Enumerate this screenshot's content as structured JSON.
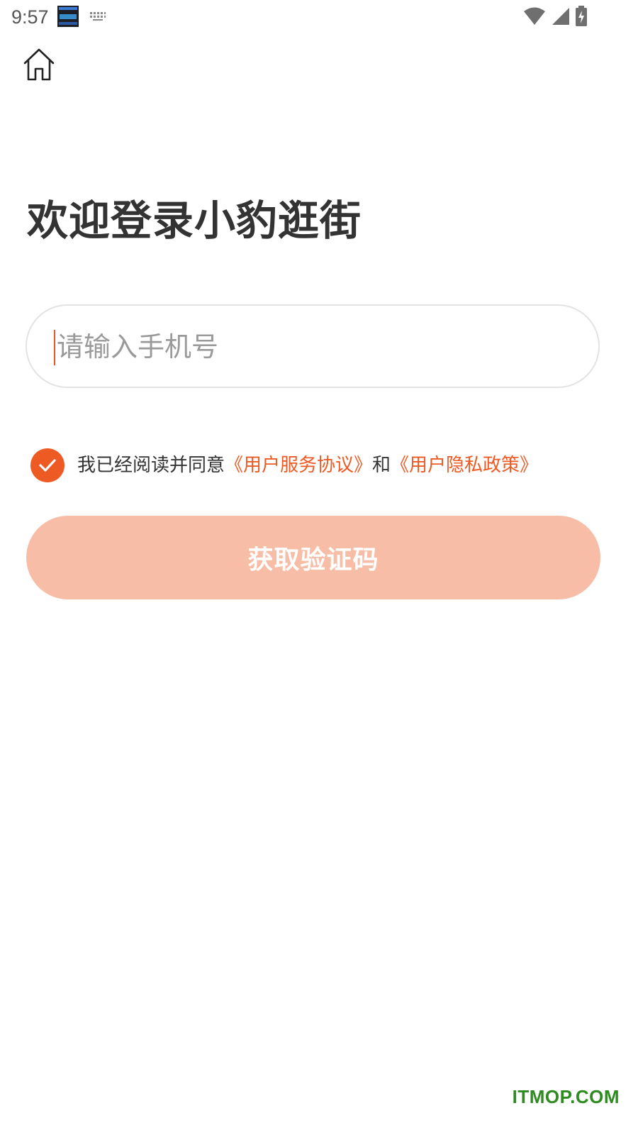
{
  "status_bar": {
    "time": "9:57"
  },
  "header": {
    "home_icon": "home-icon"
  },
  "title": "欢迎登录小豹逛街",
  "phone_input": {
    "placeholder": "请输入手机号",
    "value": ""
  },
  "agreement": {
    "checked": true,
    "prefix": "我已经阅读并同意",
    "service_link": "《用户服务协议》",
    "connector": "和",
    "privacy_link": "《用户隐私政策》"
  },
  "submit_button": {
    "label": "获取验证码",
    "enabled": false
  },
  "watermark": "ITMOP.COM",
  "colors": {
    "accent": "#ee5a24",
    "button_disabled": "#f7bda6",
    "title_text": "#333333",
    "placeholder_text": "#9a9a9a",
    "watermark": "#2e8b1f"
  }
}
